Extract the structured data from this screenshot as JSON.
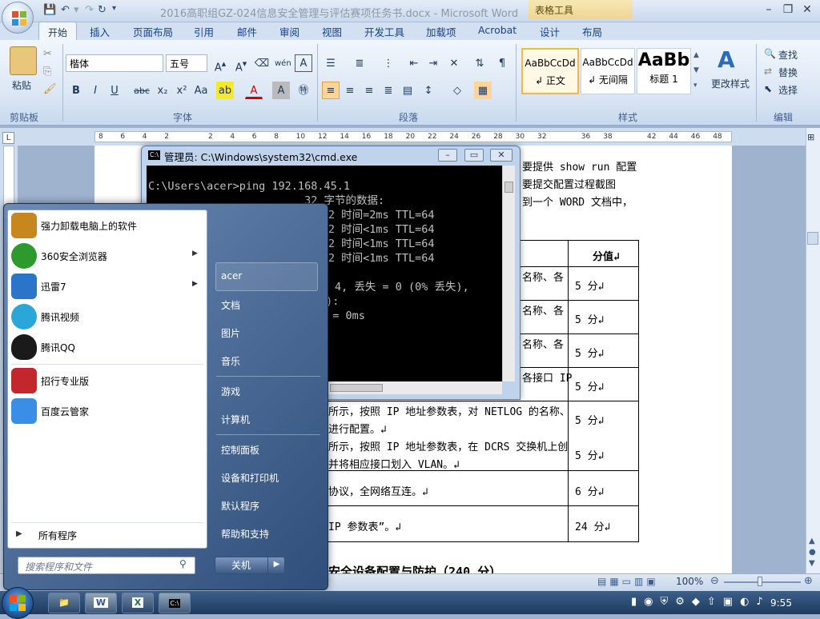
{
  "window": {
    "title": "2016高职组GZ-024信息安全管理与评估赛项任务书.docx - Microsoft Word",
    "context_tab": "表格工具"
  },
  "ribbon": {
    "tabs": [
      "开始",
      "插入",
      "页面布局",
      "引用",
      "邮件",
      "审阅",
      "视图",
      "开发工具",
      "加载项",
      "Acrobat",
      "设计",
      "布局"
    ],
    "groups": {
      "clipboard": "剪贴板",
      "font": "字体",
      "paragraph": "段落",
      "styles": "样式",
      "editing": "编辑"
    },
    "paste_label": "粘贴",
    "font_name": "楷体",
    "font_size": "五号",
    "styles": [
      {
        "preview": "AaBbCcDd",
        "name": "↲ 正文"
      },
      {
        "preview": "AaBbCcDd",
        "name": "↲ 无间隔"
      },
      {
        "preview": "AaBb",
        "name": "标题 1"
      }
    ],
    "change_styles": "更改样式",
    "find": "查找",
    "replace": "替换",
    "select": "选择"
  },
  "ruler": {
    "marks": [
      "8",
      "6",
      "4",
      "2",
      "",
      "2",
      "4",
      "6",
      "8",
      "10",
      "12",
      "14",
      "16",
      "18",
      "20",
      "22",
      "24",
      "26",
      "28",
      "30",
      "32",
      "",
      "36",
      "38",
      "",
      "42",
      "44",
      "46",
      "48"
    ]
  },
  "document": {
    "lines_right": [
      "要提供 show run 配置",
      "要提交配置过程截图",
      "到一个 WORD 文档中，"
    ],
    "table_header": "分值↲",
    "rows": [
      {
        "text": "名称、各",
        "score": "5 分↲"
      },
      {
        "text": "名称、各",
        "score": "5 分↲"
      },
      {
        "text": "名称、各",
        "score": "5 分↲"
      },
      {
        "text": "各接口 IP",
        "score": "5 分↲"
      },
      {
        "text": "所示，按照 IP 地址参数表，对 NETLOG 的名称、",
        "text2": "进行配置。↲",
        "score": "5 分↲"
      },
      {
        "text": "所示，按照 IP 地址参数表，在 DCRS 交换机上创",
        "text2": "并将相应接口划入 VLAN。↲",
        "score": "5 分↲"
      },
      {
        "text": "协议，全网络互连。↲",
        "score": "6 分↲"
      },
      {
        "text": "IP 参数表”。↲",
        "score": "24 分↲"
      }
    ],
    "heading_partial": "安全设备配置与防护（240 分）"
  },
  "status": {
    "zoom": "100%"
  },
  "cmd": {
    "title": "管理员: C:\\Windows\\system32\\cmd.exe",
    "lines": [
      "C:\\Users\\acer>ping 192.168.45.1",
      "",
      "                        32 字节的数据:",
      "                        节=32 时间=2ms TTL=64",
      "                        节=32 时间<1ms TTL=64",
      "                        节=32 时间<1ms TTL=64",
      "                        节=32 时间<1ms TTL=64",
      "",
      "                        息:",
      "                        收 = 4, 丢失 = 0 (0% 丢失),",
      "                        单位):",
      "                        平均 = 0ms"
    ]
  },
  "start_menu": {
    "programs": [
      {
        "label": "强力卸载电脑上的软件",
        "icon": "uninstall-icon",
        "color": "#c8861f",
        "arrow": false
      },
      {
        "label": "360安全浏览器",
        "icon": "browser-360-icon",
        "color": "#2c9a2c",
        "arrow": true
      },
      {
        "label": "迅雷7",
        "icon": "thunder-icon",
        "color": "#2a74c9",
        "arrow": true
      },
      {
        "label": "腾讯视频",
        "icon": "tencent-video-icon",
        "color": "#2aa6d8",
        "arrow": false
      },
      {
        "label": "腾讯QQ",
        "icon": "qq-icon",
        "color": "#1a1a1a",
        "arrow": false
      },
      {
        "label": "招行专业版",
        "icon": "cmb-icon",
        "color": "#c3262c",
        "arrow": false
      },
      {
        "label": "百度云管家",
        "icon": "baidu-cloud-icon",
        "color": "#3a8ee6",
        "arrow": false
      }
    ],
    "all_programs": "所有程序",
    "search_placeholder": "搜索程序和文件",
    "right_items": [
      "acer",
      "文档",
      "图片",
      "音乐",
      "游戏",
      "计算机",
      "控制面板",
      "设备和打印机",
      "默认程序",
      "帮助和支持"
    ],
    "shutdown": "关机"
  },
  "taskbar": {
    "time": "9:55"
  }
}
